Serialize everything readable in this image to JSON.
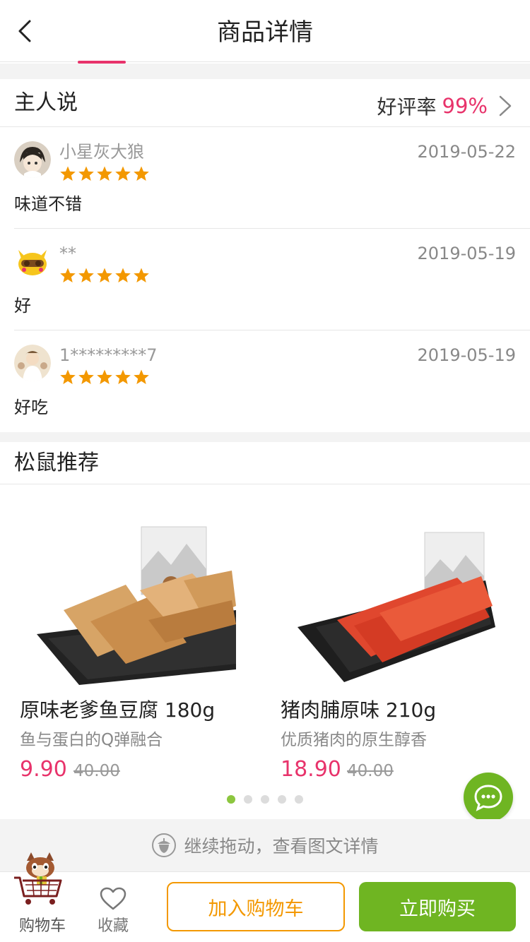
{
  "header": {
    "title": "商品详情",
    "back_icon": "chevron-left-icon"
  },
  "reviews_section": {
    "title": "主人说",
    "rating_label": "好评率",
    "rating_value": "99%",
    "reviews": [
      {
        "nickname": "小星灰大狼",
        "date": "2019-05-22",
        "stars": 5,
        "text": "味道不错"
      },
      {
        "nickname": "**",
        "date": "2019-05-19",
        "stars": 5,
        "text": "好"
      },
      {
        "nickname": "1*********7",
        "date": "2019-05-19",
        "stars": 5,
        "text": "好吃"
      }
    ]
  },
  "recommend_section": {
    "title": "松鼠推荐",
    "products": [
      {
        "name": "原味老爹鱼豆腐 180g",
        "subtitle": "鱼与蛋白的Q弹融合",
        "price": "9.90",
        "original_price": "40.00"
      },
      {
        "name": "猪肉脯原味 210g",
        "subtitle": "优质猪肉的原生醇香",
        "price": "18.90",
        "original_price": "40.00"
      }
    ],
    "pager": {
      "count": 5,
      "active": 0
    }
  },
  "continue_hint": "继续拖动，查看图文详情",
  "bottom_bar": {
    "cart_label": "购物车",
    "favorite_label": "收藏",
    "add_to_cart": "加入购物车",
    "buy_now": "立即购买"
  },
  "colors": {
    "accent_pink": "#e8336b",
    "accent_green": "#6fb522",
    "accent_orange": "#f39800",
    "star": "#f39800"
  }
}
